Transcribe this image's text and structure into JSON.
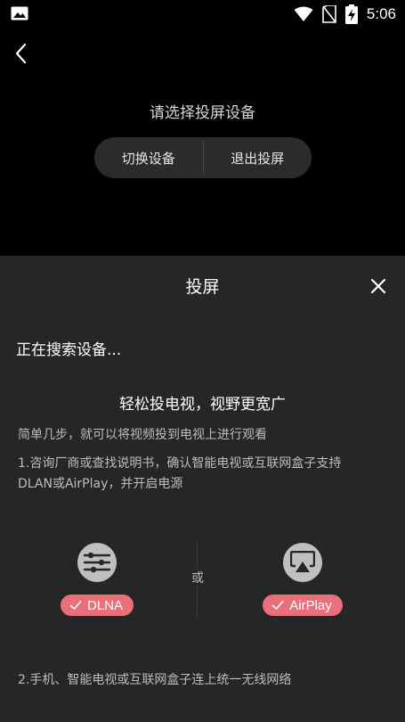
{
  "status_bar": {
    "time": "5:06",
    "icons": [
      "image-icon",
      "wifi-icon",
      "no-sim-icon",
      "battery-charging-icon"
    ]
  },
  "top": {
    "prompt": "请选择投屏设备",
    "switch_device": "切换设备",
    "exit_cast": "退出投屏"
  },
  "sheet": {
    "title": "投屏",
    "searching": "正在搜索设备...",
    "headline": "轻松投电视，视野更宽广",
    "subline": "简单几步，就可以将视频投到电视上进行观看",
    "step1_line1": "1.咨询厂商或查找说明书，确认智能电视或互联网盒子支持",
    "step1_line2": "DLAN或AirPlay，并开启电源",
    "or": "或",
    "dlna": "DLNA",
    "airplay": "AirPlay",
    "step2": "2.手机、智能电视或互联网盒子连上统一无线网络"
  },
  "colors": {
    "sheet_bg": "#262626",
    "tag_accent": "#e9707a",
    "button_bg": "#2b2b2b"
  }
}
